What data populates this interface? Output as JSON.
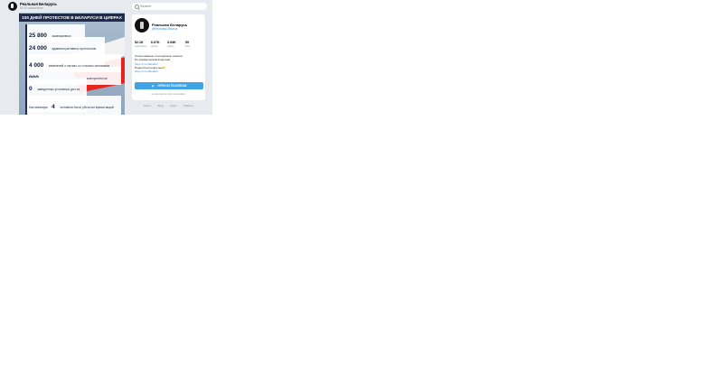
{
  "post": {
    "channel_title": "Реальная Беларусь",
    "subscribers": "52.1K subscribers"
  },
  "infographic": {
    "title": "100 ДНЕЙ ПРОТЕСТОВ В БЕЛАРУСИ В ЦИФРАХ",
    "stats": [
      {
        "num": "25 800",
        "label": "задержанных"
      },
      {
        "num": "24 000",
        "label": "административных протоколов (штрафы или арест)"
      },
      {
        "num": "4 000",
        "label": "заявлений о пытках со стороны силовиков"
      },
      {
        "num": "900",
        "label": "уголовных дел против участников протестов"
      },
      {
        "num": "0",
        "label": "заведенных уголовных дел за насилие со стороны силовиков"
      },
      {
        "num": "4",
        "label": "Как минимум 4 человека были убиты во время акций протеста при странных обстоятельствах",
        "prefix": "Как минимум",
        "suffix": "человека были убиты во время акций протеста при странных обстоятельствах"
      }
    ]
  },
  "sidebar": {
    "search_placeholder": "Search",
    "card": {
      "name": "Реальная Беларусь",
      "handle": "@Realnaya Belarus",
      "stats": [
        {
          "value": "52.1K",
          "label": "subscribers"
        },
        {
          "value": "6.67K",
          "label": "photos"
        },
        {
          "value": "3.94K",
          "label": "videos"
        },
        {
          "value": "59",
          "label": "links"
        }
      ],
      "desc_line1": "Только важные и интересные новости",
      "desc_line2": "По коммерческим вопросам:",
      "desc_link1": "https://t.me/Beallkd",
      "desc_line3": "Поделиться новостью👉",
      "desc_link2": "https://t.me/Beallkd",
      "open_button": "OPEN IN TELEGRAM",
      "join_note": "to view and join the conversation"
    },
    "footer": [
      "About",
      "Blog",
      "Apps",
      "Platform"
    ]
  },
  "colors": {
    "accent": "#3fa3e8",
    "infographic_header": "#1f2b4c",
    "flag_red": "#e3241f"
  }
}
